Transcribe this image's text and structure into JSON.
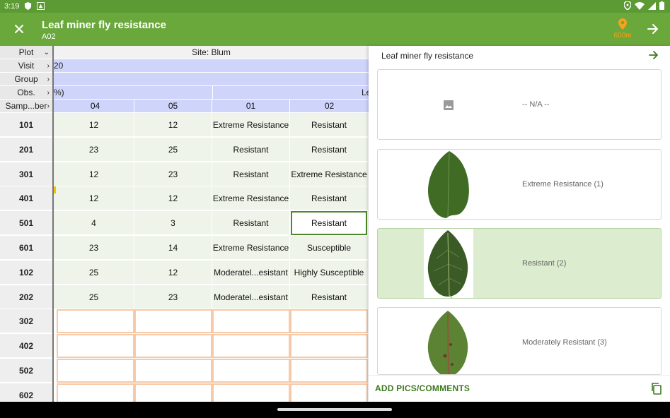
{
  "status_bar": {
    "time": "3:19"
  },
  "app_bar": {
    "title": "Leaf miner fly resistance",
    "subtitle": "A02",
    "location_label": "600m",
    "colors": {
      "bar": "#6aa83c",
      "location": "#f7a21b"
    }
  },
  "grid": {
    "header_labels": [
      "Plot",
      "Visit",
      "Group",
      "Obs.",
      "Samp...ber"
    ],
    "site_label": "Site: Blum",
    "visit_value": "20",
    "obs_fragment_left": "%)",
    "obs_fragment_right": "Le",
    "column_headers": [
      "04",
      "05",
      "01",
      "02"
    ],
    "rows": [
      {
        "id": "101",
        "cells": [
          "12",
          "12",
          "Extreme Resistance",
          "Resistant"
        ]
      },
      {
        "id": "201",
        "cells": [
          "23",
          "25",
          "Resistant",
          "Resistant"
        ]
      },
      {
        "id": "301",
        "cells": [
          "12",
          "23",
          "Resistant",
          "Extreme Resistance"
        ]
      },
      {
        "id": "401",
        "cells": [
          "12",
          "12",
          "Extreme Resistance",
          "Resistant"
        ]
      },
      {
        "id": "501",
        "cells": [
          "4",
          "3",
          "Resistant",
          "Resistant"
        ]
      },
      {
        "id": "601",
        "cells": [
          "23",
          "14",
          "Extreme Resistance",
          "Susceptible"
        ]
      },
      {
        "id": "102",
        "cells": [
          "25",
          "12",
          "Moderatel...esistant",
          "Highly Susceptible"
        ]
      },
      {
        "id": "202",
        "cells": [
          "25",
          "23",
          "Moderatel...esistant",
          "Resistant"
        ]
      },
      {
        "id": "302",
        "cells": [
          "",
          "",
          "",
          ""
        ]
      },
      {
        "id": "402",
        "cells": [
          "",
          "",
          "",
          ""
        ]
      },
      {
        "id": "502",
        "cells": [
          "",
          "",
          "",
          ""
        ]
      },
      {
        "id": "602",
        "cells": [
          "",
          "",
          "",
          ""
        ]
      }
    ]
  },
  "panel": {
    "title": "Leaf miner fly resistance",
    "options": [
      {
        "label": "-- N/A --",
        "image": "image-placeholder-icon"
      },
      {
        "label": "Extreme Resistance (1)",
        "image": "leaf-image"
      },
      {
        "label": "Resistant (2)",
        "image": "leaf-image"
      },
      {
        "label": "Moderately Resistant (3)",
        "image": "leaf-image"
      }
    ],
    "footer_button": "ADD PICS/COMMENTS"
  }
}
